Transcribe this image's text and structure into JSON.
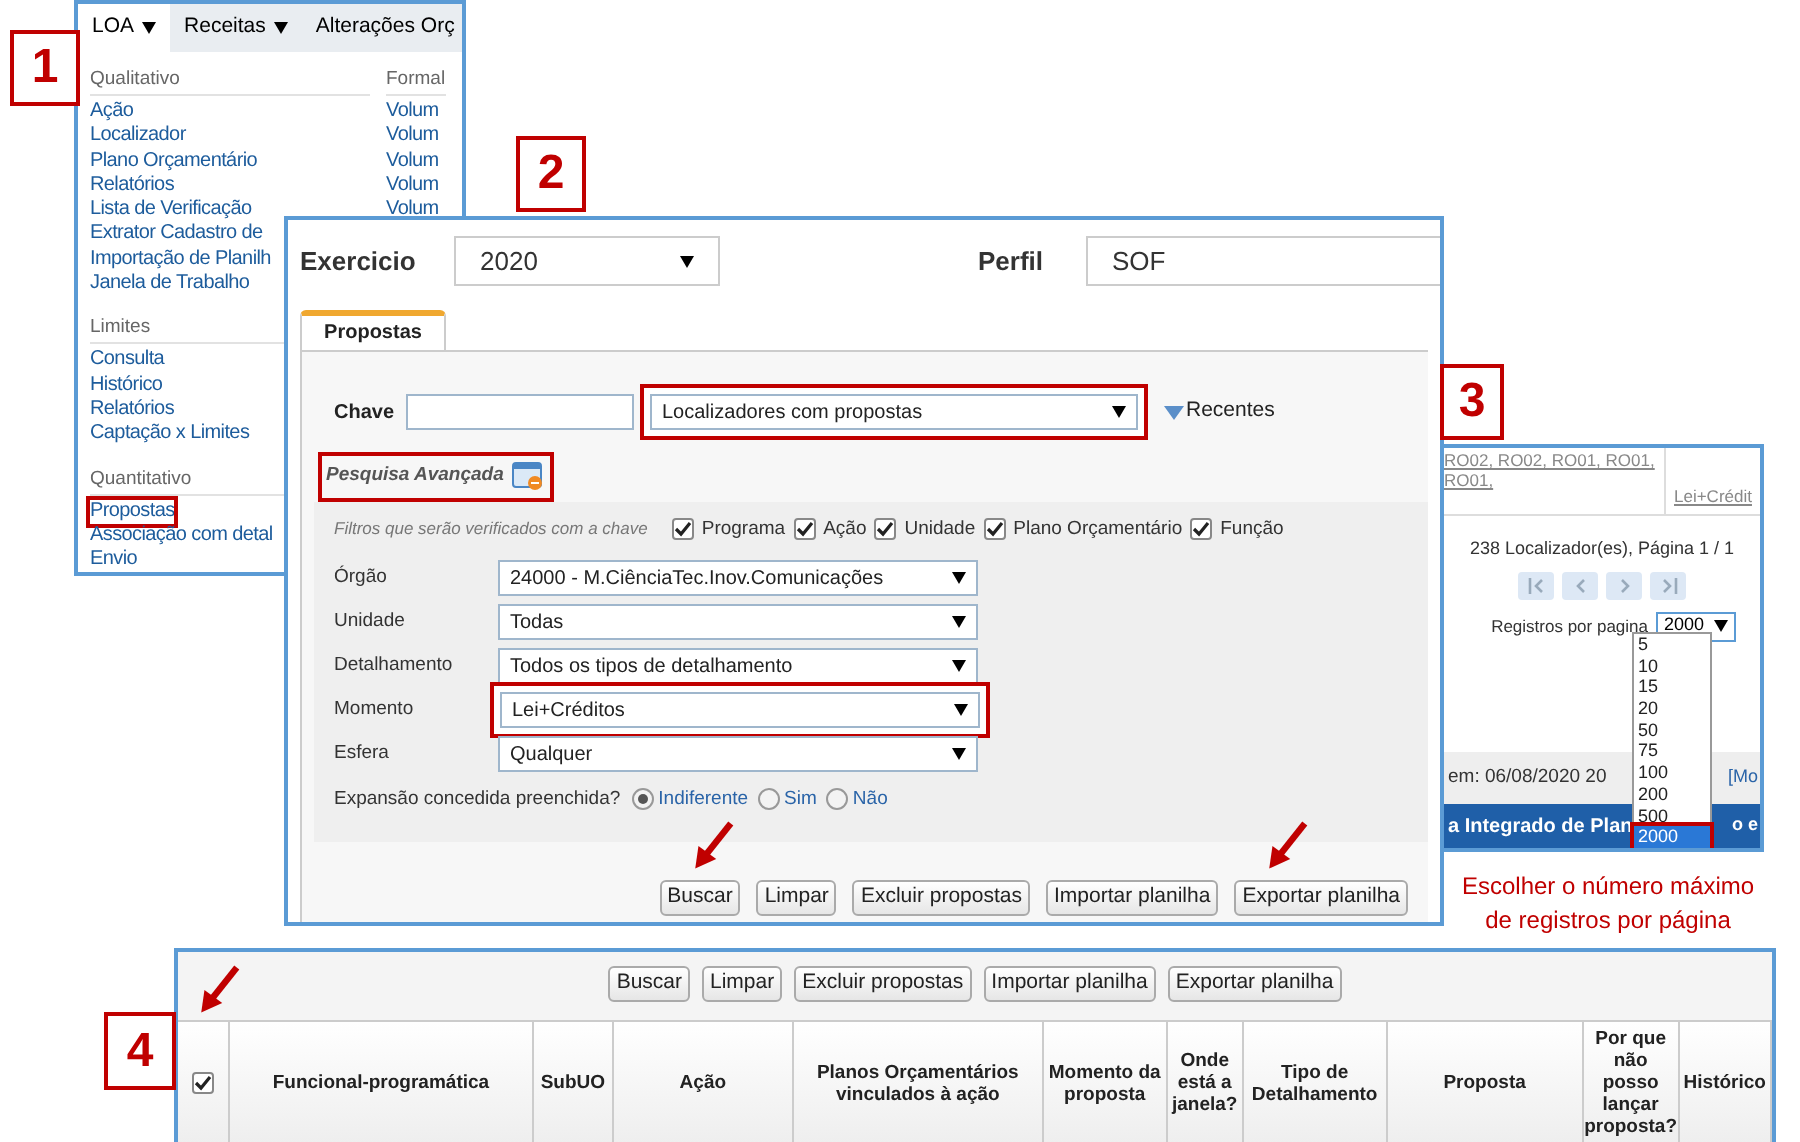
{
  "menu_panel": {
    "step": "1",
    "menubar": [
      {
        "label": "LOA",
        "dropdown": true,
        "selected": true
      },
      {
        "label": "Receitas",
        "dropdown": true,
        "selected": false
      },
      {
        "label": "Alterações Orç",
        "dropdown": false,
        "selected": false
      }
    ],
    "columns": [
      {
        "sections": [
          {
            "title": "Qualitativo",
            "items": [
              {
                "label": "Ação",
                "highlighted": false
              },
              {
                "label": "Localizador",
                "highlighted": false
              },
              {
                "label": "Plano Orçamentário",
                "highlighted": false
              },
              {
                "label": "Relatórios",
                "highlighted": false
              },
              {
                "label": "Lista de Verificação",
                "highlighted": false
              },
              {
                "label": "Extrator Cadastro de",
                "highlighted": false
              },
              {
                "label": "Importação de Planilh",
                "highlighted": false
              },
              {
                "label": "Janela de Trabalho",
                "highlighted": false
              }
            ]
          },
          {
            "title": "Limites",
            "items": [
              {
                "label": "Consulta",
                "highlighted": false
              },
              {
                "label": "Histórico",
                "highlighted": false
              },
              {
                "label": "Relatórios",
                "highlighted": false
              },
              {
                "label": "Captação x Limites",
                "highlighted": false
              }
            ]
          },
          {
            "title": "Quantitativo",
            "items": [
              {
                "label": "Propostas",
                "highlighted": true
              },
              {
                "label": "Associação com detal",
                "highlighted": false
              },
              {
                "label": "Envio",
                "highlighted": false
              }
            ]
          }
        ]
      },
      {
        "sections": [
          {
            "title": "Formal",
            "items": [
              {
                "label": "Volum",
                "highlighted": false
              },
              {
                "label": "Volum",
                "highlighted": false
              },
              {
                "label": "Volum",
                "highlighted": false
              },
              {
                "label": "Volum",
                "highlighted": false
              },
              {
                "label": "Volum",
                "highlighted": false
              }
            ]
          }
        ]
      }
    ]
  },
  "search_panel": {
    "step": "2",
    "exercicio": {
      "label": "Exercicio",
      "value": "2020"
    },
    "perfil": {
      "label": "Perfil",
      "value": "SOF"
    },
    "tabs": [
      {
        "label": "Propostas",
        "selected": true
      }
    ],
    "chave": {
      "label": "Chave"
    },
    "query": {
      "value": "Localizadores com propostas",
      "highlighted": true
    },
    "recentes": "Recentes",
    "advanced": {
      "label": "Pesquisa Avançada",
      "highlighted": true
    },
    "filters_label": "Filtros que serão verificados com a chave",
    "filters": [
      {
        "label": "Programa",
        "checked": true
      },
      {
        "label": "Ação",
        "checked": true
      },
      {
        "label": "Unidade",
        "checked": true
      },
      {
        "label": "Plano Orçamentário",
        "checked": true
      },
      {
        "label": "Função",
        "checked": true
      }
    ],
    "fields": [
      {
        "label": "Órgão",
        "value": "24000 - M.CiênciaTec.Inov.Comunicações",
        "highlighted": false
      },
      {
        "label": "Unidade",
        "value": "Todas",
        "highlighted": false
      },
      {
        "label": "Detalhamento",
        "value": "Todos os tipos de detalhamento",
        "highlighted": false
      },
      {
        "label": "Momento",
        "value": "Lei+Créditos",
        "highlighted": true
      },
      {
        "label": "Esfera",
        "value": "Qualquer",
        "highlighted": false
      }
    ],
    "expansion": {
      "label": "Expansão concedida preenchida?",
      "options": [
        {
          "label": "Indiferente",
          "selected": true
        },
        {
          "label": "Sim",
          "selected": false
        },
        {
          "label": "Não",
          "selected": false
        }
      ]
    },
    "buttons": [
      {
        "label": "Buscar",
        "arrow": true
      },
      {
        "label": "Limpar",
        "arrow": false
      },
      {
        "label": "Excluir propostas",
        "arrow": false
      },
      {
        "label": "Importar planilha",
        "arrow": false
      },
      {
        "label": "Exportar planilha",
        "arrow": true
      }
    ]
  },
  "results_panel": {
    "step": "3",
    "codes": "RO02, RO02, RO01, RO01, RO01,",
    "moment": "Lei+Crédit",
    "summary": "238 Localizador(es), Página 1 / 1",
    "page_size_label": "Registros por pagina",
    "page_size": "2000",
    "options": [
      {
        "label": "5",
        "selected": false
      },
      {
        "label": "10",
        "selected": false
      },
      {
        "label": "15",
        "selected": false
      },
      {
        "label": "20",
        "selected": false
      },
      {
        "label": "50",
        "selected": false
      },
      {
        "label": "75",
        "selected": false
      },
      {
        "label": "100",
        "selected": false
      },
      {
        "label": "200",
        "selected": false
      },
      {
        "label": "500",
        "selected": false
      },
      {
        "label": "2000",
        "selected": true
      }
    ],
    "date_text": "em: 06/08/2020 20",
    "link_text": "[Mo",
    "banner_start": "a Integrado de Plan",
    "banner_end": "o e",
    "caption": "Escolher o número máximo de registros por página"
  },
  "table_panel": {
    "step": "4",
    "buttons": [
      "Buscar",
      "Limpar",
      "Excluir propostas",
      "Importar planilha",
      "Exportar planilha"
    ],
    "select_all": {
      "checked": true,
      "arrow": true
    },
    "columns": [
      "Funcional-programática",
      "SubUO",
      "Ação",
      "Planos Orçamentários vinculados à ação",
      "Momento da proposta",
      "Onde está a janela?",
      "Tipo de Detalhamento",
      "Proposta",
      "Por que não posso lançar proposta?",
      "Histórico"
    ]
  }
}
